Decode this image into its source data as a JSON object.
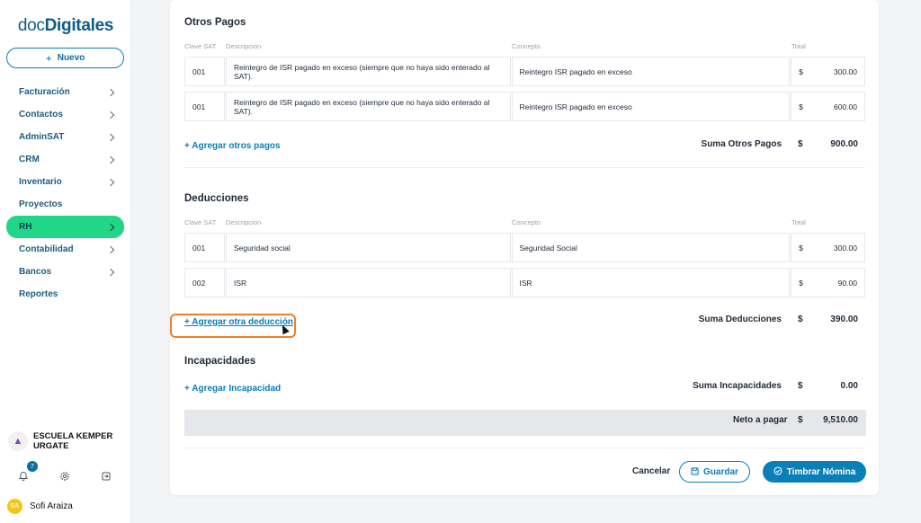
{
  "sidebar": {
    "logo_part1": "doc",
    "logo_part2": "Digitales",
    "new_button": "Nuevo",
    "items": [
      {
        "label": "Facturación",
        "chevron": true
      },
      {
        "label": "Contactos",
        "chevron": true
      },
      {
        "label": "AdminSAT",
        "chevron": true
      },
      {
        "label": "CRM",
        "chevron": true
      },
      {
        "label": "Inventario",
        "chevron": true
      },
      {
        "label": "Proyectos",
        "chevron": false
      },
      {
        "label": "RH",
        "chevron": true,
        "active": true
      },
      {
        "label": "Contabilidad",
        "chevron": true
      },
      {
        "label": "Bancos",
        "chevron": true
      },
      {
        "label": "Reportes",
        "chevron": false
      }
    ],
    "org_name": "ESCUELA KEMPER URGATE",
    "notifications_count": "7",
    "user_initials": "SA",
    "user_name": "Sofi Araiza"
  },
  "columns": {
    "clave": "Clave SAT",
    "descripcion": "Descripción",
    "concepto": "Concepto",
    "total": "Total"
  },
  "otros_pagos": {
    "title": "Otros Pagos",
    "rows": [
      {
        "clave": "001",
        "descripcion": "Reintegro de ISR pagado en exceso (siempre que no haya sido enterado al SAT).",
        "concepto": "Reintegro ISR pagado en exceso",
        "currency": "$",
        "total": "300.00"
      },
      {
        "clave": "001",
        "descripcion": "Reintegro de ISR pagado en exceso (siempre que no haya sido enterado al SAT).",
        "concepto": "Reintegro ISR pagado en exceso",
        "currency": "$",
        "total": "600.00"
      }
    ],
    "add_link": "+ Agregar otros pagos",
    "sum_label": "Suma Otros Pagos",
    "sum_currency": "$",
    "sum_value": "900.00"
  },
  "deducciones": {
    "title": "Deducciones",
    "rows": [
      {
        "clave": "001",
        "descripcion": "Seguridad social",
        "concepto": "Seguridad Social",
        "currency": "$",
        "total": "300.00"
      },
      {
        "clave": "002",
        "descripcion": "ISR",
        "concepto": "ISR",
        "currency": "$",
        "total": "90.00"
      }
    ],
    "add_link": "+ Agregar otra deducción",
    "sum_label": "Suma Deducciones",
    "sum_currency": "$",
    "sum_value": "390.00"
  },
  "incapacidades": {
    "title": "Incapacidades",
    "add_link": "+ Agregar Incapacidad",
    "sum_label": "Suma Incapacidades",
    "sum_currency": "$",
    "sum_value": "0.00"
  },
  "neto": {
    "label": "Neto a pagar",
    "currency": "$",
    "value": "9,510.00"
  },
  "actions": {
    "cancel": "Cancelar",
    "save": "Guardar",
    "stamp": "Timbrar Nómina"
  },
  "colors": {
    "primary": "#0a7fb8",
    "active_nav": "#22d688",
    "highlight": "#ef7d2a"
  }
}
